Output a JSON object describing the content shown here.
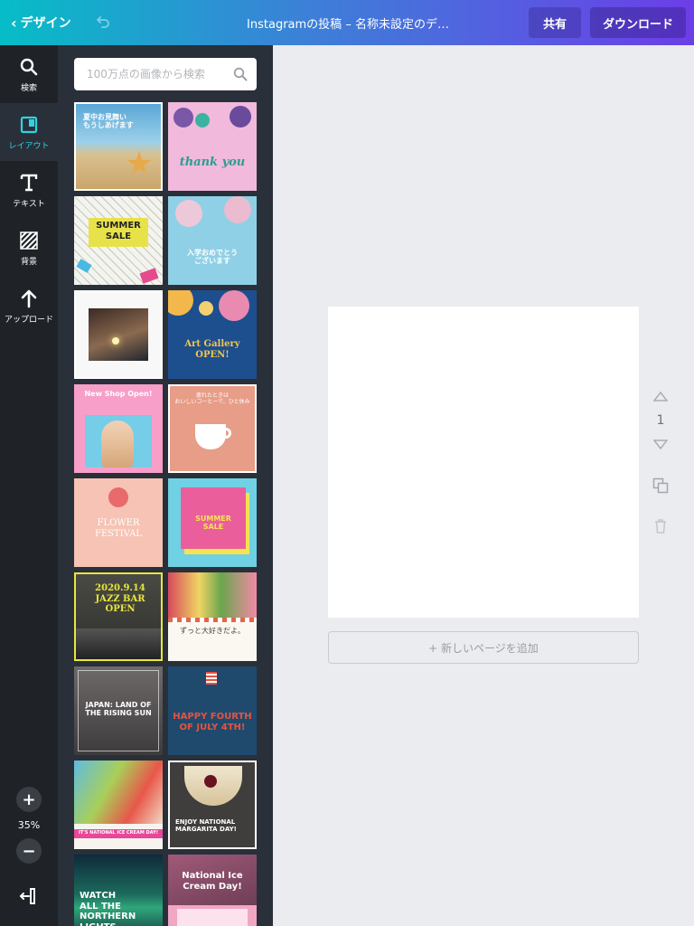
{
  "topbar": {
    "back_label": "デザイン",
    "doc_title": "Instagramの投稿 – 名称未設定のデ…",
    "share_label": "共有",
    "download_label": "ダウンロード"
  },
  "rail": {
    "items": [
      {
        "label": "検索",
        "icon": "search-icon"
      },
      {
        "label": "レイアウト",
        "icon": "layout-icon"
      },
      {
        "label": "テキスト",
        "icon": "text-icon"
      },
      {
        "label": "背景",
        "icon": "background-icon"
      },
      {
        "label": "アップロード",
        "icon": "upload-icon"
      }
    ],
    "zoom_in": "+",
    "zoom_out": "−",
    "zoom_value": "35%"
  },
  "panel": {
    "search_placeholder": "100万点の画像から検索",
    "templates": [
      {
        "text": "夏中お見舞い\nもうしあげます"
      },
      {
        "text": "thank you"
      },
      {
        "text": "SUMMER\nSALE"
      },
      {
        "text": "入学おめでとう\nございます"
      },
      {
        "text": ""
      },
      {
        "text": "Art Gallery\nOPEN!"
      },
      {
        "text": "New Shop Open!"
      },
      {
        "text": "疲れたときは\nおいしいコーヒーで、ひと休み"
      },
      {
        "text": "FLOWER\nFESTIVAL"
      },
      {
        "text": "SUMMER\nSALE"
      },
      {
        "text": "2020.9.14\nJAZZ BAR OPEN"
      },
      {
        "text": "ずっと大好きだよ。"
      },
      {
        "text": "JAPAN: LAND OF\nTHE RISING SUN"
      },
      {
        "text": "HAPPY FOURTH\nOF JULY 4TH!"
      },
      {
        "text": "IT'S NATIONAL ICE CREAM DAY!"
      },
      {
        "text": "ENJOY NATIONAL\nMARGARITA DAY!"
      },
      {
        "text": "WATCH\nALL THE\nNORTHERN\nLIGHTS"
      },
      {
        "text": "National Ice\nCream Day!"
      }
    ]
  },
  "canvas": {
    "add_page_label": "+ 新しいページを追加",
    "page_number": "1"
  },
  "colors": {
    "accent": "#2fd3e0",
    "rail_bg": "#1f2327",
    "panel_bg": "#293039",
    "canvas_bg": "#ebecf0"
  }
}
